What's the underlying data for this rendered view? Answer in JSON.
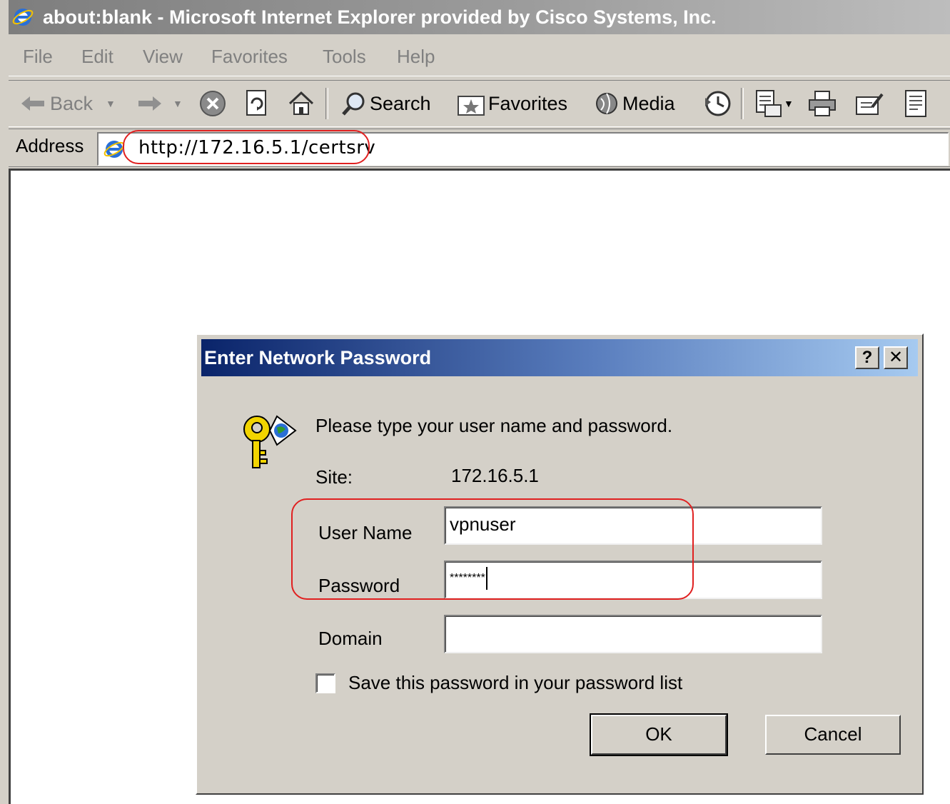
{
  "window": {
    "title": "about:blank - Microsoft Internet Explorer provided by Cisco Systems, Inc."
  },
  "menu": {
    "items": [
      "File",
      "Edit",
      "View",
      "Favorites",
      "Tools",
      "Help"
    ]
  },
  "toolbar": {
    "back_label": "Back",
    "search_label": "Search",
    "favorites_label": "Favorites",
    "media_label": "Media"
  },
  "address": {
    "label": "Address",
    "url": "http://172.16.5.1/certsrv"
  },
  "dialog": {
    "title": "Enter Network Password",
    "help_label": "?",
    "close_label": "✕",
    "prompt": "Please type your user name and password.",
    "site_label": "Site:",
    "site_value": "172.16.5.1",
    "username_label": "User Name",
    "username_value": "vpnuser",
    "password_label": "Password",
    "password_value": "********",
    "domain_label": "Domain",
    "domain_value": "",
    "save_password_label": "Save this password in your password list",
    "save_password_checked": false,
    "ok_label": "OK",
    "cancel_label": "Cancel"
  },
  "colors": {
    "dialog_title_start": "#0a246a",
    "dialog_title_end": "#a6caf0",
    "chrome": "#d4d0c8",
    "highlight": "#e02020"
  }
}
